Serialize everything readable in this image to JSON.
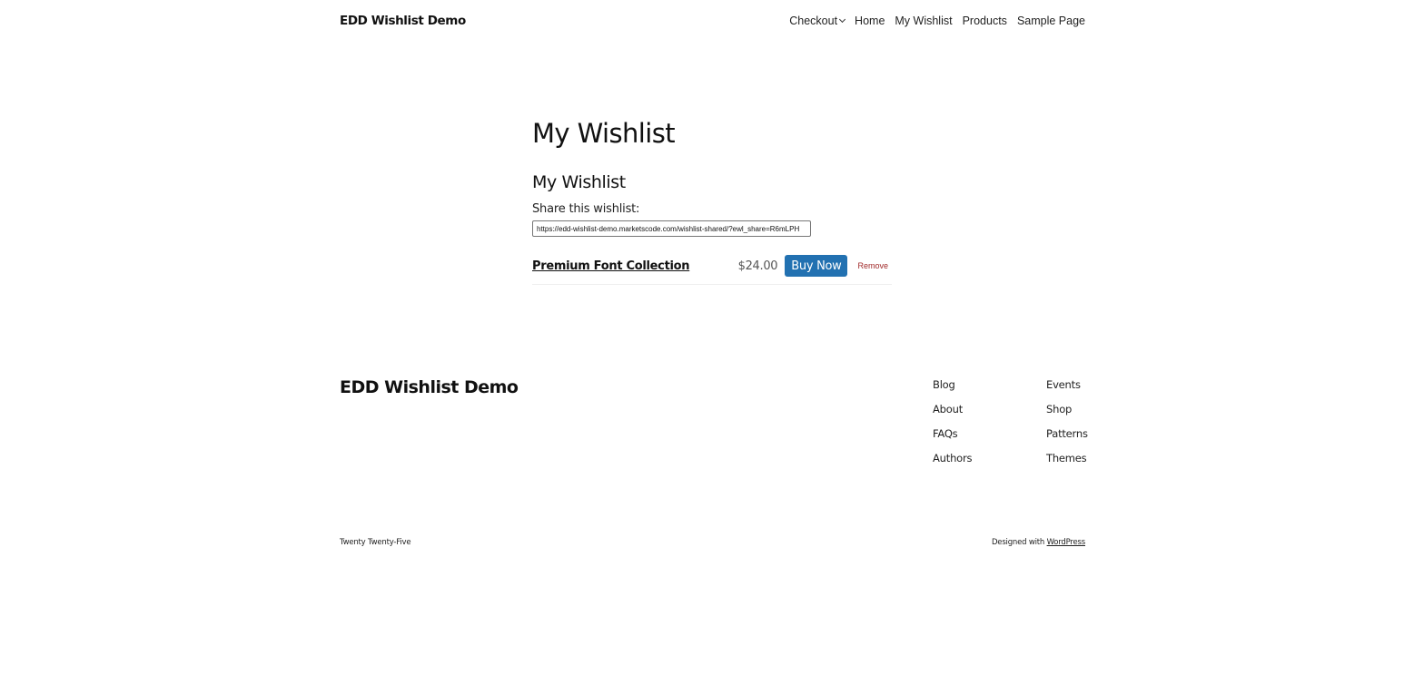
{
  "header": {
    "site_title": "EDD Wishlist Demo",
    "nav": [
      {
        "label": "Checkout",
        "has_submenu": true
      },
      {
        "label": "Home"
      },
      {
        "label": "My Wishlist"
      },
      {
        "label": "Products"
      },
      {
        "label": "Sample Page"
      }
    ]
  },
  "main": {
    "page_title": "My Wishlist",
    "section_title": "My Wishlist",
    "share_label": "Share this wishlist:",
    "share_url": "https://edd-wishlist-demo.marketscode.com/wishlist-shared/?ewl_share=R6mLPH",
    "items": [
      {
        "name": "Premium Font Collection",
        "price": "$24.00",
        "buy_label": "Buy Now",
        "remove_label": "Remove"
      }
    ]
  },
  "footer": {
    "site_title": "EDD Wishlist Demo",
    "nav_col1": [
      "Blog",
      "About",
      "FAQs",
      "Authors"
    ],
    "nav_col2": [
      "Events",
      "Shop",
      "Patterns",
      "Themes"
    ],
    "theme_name": "Twenty Twenty-Five",
    "credit_prefix": "Designed with ",
    "credit_link": "WordPress"
  },
  "colors": {
    "accent": "#2271b1",
    "remove": "#a02828"
  },
  "icons": {
    "submenu": "chevron-down-icon"
  }
}
